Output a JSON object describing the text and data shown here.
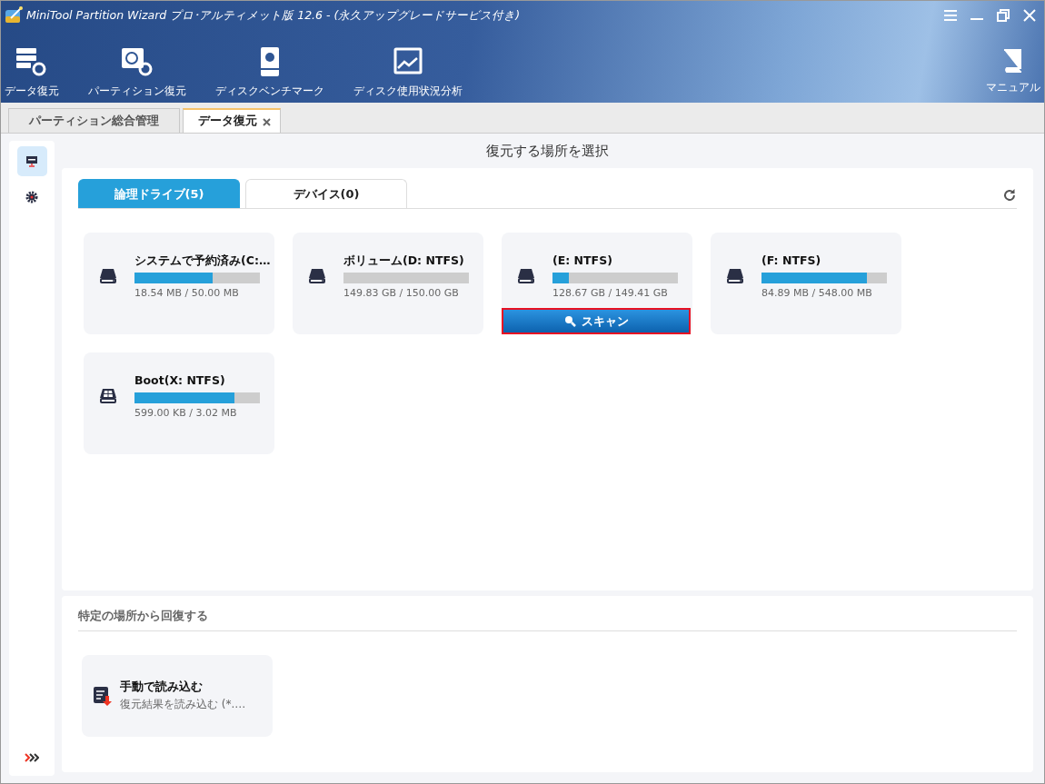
{
  "window": {
    "title": "MiniTool Partition Wizard プロ･アルティメット版 12.6 - (永久アップグレードサービス付き)"
  },
  "toolbar": [
    {
      "label": "データ復元",
      "kind": "data"
    },
    {
      "label": "パーティション復元",
      "kind": "partition"
    },
    {
      "label": "ディスクベンチマーク",
      "kind": "benchmark"
    },
    {
      "label": "ディスク使用状況分析",
      "kind": "usage"
    }
  ],
  "manual": {
    "label": "マニュアル"
  },
  "doc_tabs": [
    {
      "label": "パーティション総合管理",
      "selected": false,
      "closable": false
    },
    {
      "label": "データ復元",
      "selected": true,
      "closable": true
    }
  ],
  "sidebar": [
    {
      "kind": "monitor",
      "selected": true
    },
    {
      "kind": "gear",
      "selected": false
    }
  ],
  "heading": "復元する場所を選択",
  "drive_tabs": [
    {
      "label": "論理ドライブ(5)",
      "selected": true
    },
    {
      "label": "デバイス(0)",
      "selected": false
    }
  ],
  "drives": [
    {
      "name": "システムで予約済み(C:…",
      "kind": "hdd",
      "level": 0.62,
      "size": "18.54 MB / 50.00 MB"
    },
    {
      "name": "ボリューム(D: NTFS)",
      "kind": "hdd",
      "level": 0,
      "size": "149.83 GB / 150.00 GB"
    },
    {
      "name": "(E: NTFS)",
      "kind": "hdd",
      "level": 0.13,
      "size": "128.67 GB / 149.41 GB",
      "scan_button": "スキャン"
    },
    {
      "name": "(F: NTFS)",
      "kind": "hdd",
      "level": 0.84,
      "size": "84.89 MB / 548.00 MB"
    },
    {
      "name": "Boot(X: NTFS)",
      "kind": "windows",
      "level": 0.8,
      "size": "599.00 KB / 3.02 MB"
    }
  ],
  "specific": {
    "title": "特定の場所から回復する",
    "items": [
      {
        "title": "手動で読み込む",
        "subtitle": "復元結果を読み込む (*.…"
      }
    ]
  }
}
